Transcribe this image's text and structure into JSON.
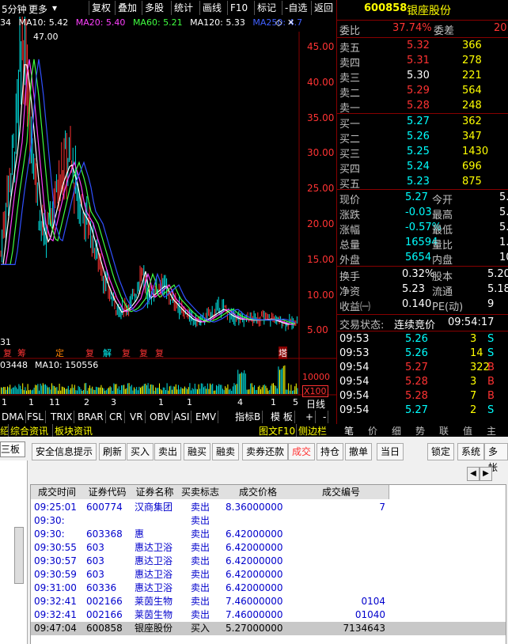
{
  "toolbar": {
    "period": "5分钟",
    "more": "更多",
    "buttons": [
      "复权",
      "叠加",
      "多股",
      "统计",
      "画线",
      "F10",
      "标记",
      "-自选",
      "返回"
    ]
  },
  "ma": {
    "prefix": "34",
    "ma10": "MA10: 5.42",
    "ma20": "MA20: 5.40",
    "ma60": "MA60: 5.21",
    "ma120": "MA120: 5.33",
    "ma250": "MA250: 4.7",
    "peak": "47.00",
    "low": "31"
  },
  "colors": {
    "up": "#ff3333",
    "down": "#00e0e0",
    "yellow": "#ffff00",
    "label": "#c0c0c0",
    "blue": "#6fa0ff"
  },
  "axis": {
    "y_labels": [
      "45.00",
      "40.00",
      "35.00",
      "30.00",
      "25.00",
      "20.00",
      "15.00",
      "10.00",
      "5.00"
    ],
    "vol_labels": [
      "10000",
      "X100"
    ],
    "vol_row": "03448",
    "vol_ma": "MA10: 150556",
    "x_labels": [
      "1",
      "1",
      "11",
      "2",
      "3",
      "1",
      "1",
      "4",
      "1",
      "5"
    ],
    "day_line": "日线"
  },
  "markers": [
    "复",
    "筹",
    "定",
    "复",
    "解",
    "复",
    "复",
    "复",
    "塔"
  ],
  "tabs": [
    "DMA",
    "FSL",
    "TRIX",
    "BRAR",
    "CR",
    "VR",
    "OBV",
    "ASI",
    "EMV",
    "指标B",
    "模 板",
    "+",
    "-"
  ],
  "info_tabs": [
    "介绍",
    "综合资讯",
    "板块资讯",
    "图文F10",
    "侧边栏"
  ],
  "side_tabs": [
    "笔",
    "价",
    "细",
    "势",
    "联",
    "值",
    "主"
  ],
  "quote": {
    "code": "600858",
    "name": "银座股份",
    "weibi_label": "委比",
    "weibi": "37.74%",
    "weicha_label": "委差",
    "weicha": "20",
    "sells": [
      [
        "卖五",
        "5.32",
        "366"
      ],
      [
        "卖四",
        "5.31",
        "278"
      ],
      [
        "卖三",
        "5.30",
        "221"
      ],
      [
        "卖二",
        "5.29",
        "564"
      ],
      [
        "卖一",
        "5.28",
        "248"
      ]
    ],
    "buys": [
      [
        "买一",
        "5.27",
        "362"
      ],
      [
        "买二",
        "5.26",
        "347"
      ],
      [
        "买三",
        "5.25",
        "1430"
      ],
      [
        "买四",
        "5.24",
        "696"
      ],
      [
        "买五",
        "5.23",
        "875"
      ]
    ],
    "stats": [
      [
        "现价",
        "5.27",
        "今开",
        "5."
      ],
      [
        "涨跌",
        "-0.03",
        "最高",
        "5."
      ],
      [
        "涨幅",
        "-0.57%",
        "最低",
        "5."
      ],
      [
        "总量",
        "16594",
        "量比",
        "1."
      ],
      [
        "外盘",
        "5654",
        "内盘",
        "109"
      ]
    ],
    "stats2": [
      [
        "换手",
        "0.32%",
        "股本",
        "5.20"
      ],
      [
        "净资",
        "5.23",
        "流通",
        "5.18"
      ],
      [
        "收益㈠",
        "0.140",
        "PE(动)",
        "9"
      ]
    ],
    "status_label": "交易状态:",
    "status": "连续竞价",
    "status_time": "09:54:17",
    "ticks": [
      [
        "09:53",
        "5.26",
        "3",
        "S"
      ],
      [
        "09:53",
        "5.26",
        "14",
        "S"
      ],
      [
        "09:54",
        "5.27",
        "322",
        "B"
      ],
      [
        "09:54",
        "5.28",
        "3",
        "B"
      ],
      [
        "09:54",
        "5.28",
        "7",
        "B"
      ],
      [
        "09:54",
        "5.27",
        "2",
        "S"
      ]
    ]
  },
  "panel": {
    "side_label": "三板",
    "buttons": [
      "安全信息提示",
      "刷新",
      "买入",
      "卖出",
      "融买",
      "融卖",
      "卖券还款",
      "成交",
      "持仓",
      "撤单",
      "当日",
      "锁定",
      "系统",
      "多帐"
    ],
    "headers": [
      "成交时间",
      "证券代码",
      "证券名称",
      "买卖标志",
      "成交价格",
      "成交编号"
    ],
    "rows": [
      [
        "09:25:01",
        "600774",
        "汉商集团",
        "卖出",
        "8.36000000",
        "7"
      ],
      [
        "09:30:",
        "",
        "",
        "卖出",
        "",
        ""
      ],
      [
        "09:30:",
        "603368",
        "惠",
        "卖出",
        "6.42000000",
        ""
      ],
      [
        "09:30:55",
        "603",
        "惠达卫浴",
        "卖出",
        "6.42000000",
        ""
      ],
      [
        "09:30:57",
        "603",
        "惠达卫浴",
        "卖出",
        "6.42000000",
        ""
      ],
      [
        "09:30:59",
        "603",
        "惠达卫浴",
        "卖出",
        "6.42000000",
        ""
      ],
      [
        "09:31:00",
        "60336",
        "惠达卫浴",
        "卖出",
        "6.42000000",
        ""
      ],
      [
        "09:32:41",
        "002166",
        "莱茵生物",
        "卖出",
        "7.46000000",
        "0104"
      ],
      [
        "09:32:41",
        "002166",
        "莱茵生物",
        "卖出",
        "7.46000000",
        "01040"
      ],
      [
        "09:47:04",
        "600858",
        "银座股份",
        "买入",
        "5.27000000",
        "7134643"
      ]
    ]
  }
}
